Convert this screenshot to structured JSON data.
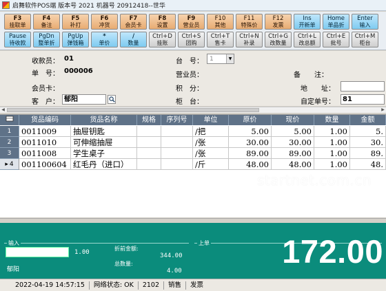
{
  "window": {
    "title": "启舞软件POS端 版本号 2021 机器号 20912418--世华"
  },
  "toolbar": {
    "row1": [
      {
        "key": "F3",
        "label": "挂取单",
        "style": "orange"
      },
      {
        "key": "F4",
        "label": "备注",
        "style": "orange"
      },
      {
        "key": "F5",
        "label": "补打",
        "style": "orange"
      },
      {
        "key": "F6",
        "label": "冲货",
        "style": "orange"
      },
      {
        "key": "F7",
        "label": "会员卡",
        "style": "orange"
      },
      {
        "key": "F8",
        "label": "设置",
        "style": "orange"
      },
      {
        "key": "F9",
        "label": "营业员",
        "style": "orange"
      },
      {
        "key": "F10",
        "label": "其他",
        "style": "orange"
      },
      {
        "key": "F11",
        "label": "特殊价",
        "style": "orange"
      },
      {
        "key": "F12",
        "label": "发票",
        "style": "orange"
      },
      {
        "key": "Ins",
        "label": "开新单",
        "style": "blue"
      },
      {
        "key": "Home",
        "label": "单品折",
        "style": "blue"
      },
      {
        "key": "Enter",
        "label": "输入",
        "style": "blue"
      }
    ],
    "row2": [
      {
        "key": "Pause",
        "label": "待收款",
        "style": "blue"
      },
      {
        "key": "PgDn",
        "label": "整单折",
        "style": "blue"
      },
      {
        "key": "PgUp",
        "label": "弹钱箱",
        "style": "blue"
      },
      {
        "key": "*",
        "label": "单价",
        "style": "blue"
      },
      {
        "key": "/",
        "label": "数量",
        "style": "blue"
      },
      {
        "key": "Ctrl+D",
        "label": "挂账",
        "style": "gray"
      },
      {
        "key": "Ctrl+S",
        "label": "团购",
        "style": "gray"
      },
      {
        "key": "Ctrl+T",
        "label": "售卡",
        "style": "gray"
      },
      {
        "key": "Ctrl+N",
        "label": "补录",
        "style": "gray"
      },
      {
        "key": "Ctrl+G",
        "label": "改数量",
        "style": "gray"
      },
      {
        "key": "Ctrl+L",
        "label": "改总额",
        "style": "gray"
      },
      {
        "key": "Ctrl+E",
        "label": "批号",
        "style": "gray"
      },
      {
        "key": "Ctrl+M",
        "label": "柜台",
        "style": "gray"
      }
    ]
  },
  "form": {
    "cashier_label": "收款员：",
    "cashier_value": "01",
    "order_label": "单　号：",
    "order_value": "000006",
    "member_label": "会员卡：",
    "customer_label": "客　户：",
    "customer_value": "郁阳",
    "platform_label": "台　号：",
    "platform_value": "1",
    "salesperson_label": "营业员：",
    "points_label": "积　分：",
    "counter_label": "柜　台：",
    "remark_label": "备　　注：",
    "address_label": "地　　址：",
    "custom_order_label": "自定单号：",
    "custom_order_value": "81"
  },
  "table": {
    "headers": [
      "货品编码",
      "货品名称",
      "规格",
      "序列号",
      "单位",
      "原价",
      "现价",
      "数量",
      "金额"
    ],
    "rows": [
      {
        "idx": "1",
        "code": "0011009",
        "name": "抽屉钥匙",
        "spec": "",
        "serial": "",
        "unit": "/把",
        "orig": "5.00",
        "price": "5.00",
        "qty": "1.00",
        "amount": "5."
      },
      {
        "idx": "2",
        "code": "0011010",
        "name": "可伸缩抽屉",
        "spec": "",
        "serial": "",
        "unit": "/张",
        "orig": "30.00",
        "price": "30.00",
        "qty": "1.00",
        "amount": "30."
      },
      {
        "idx": "3",
        "code": "0011008",
        "name": "学生桌子",
        "spec": "",
        "serial": "",
        "unit": "/张",
        "orig": "89.00",
        "price": "89.00",
        "qty": "1.00",
        "amount": "89."
      },
      {
        "idx": "4",
        "code": "001100604",
        "name": "红毛丹（进口）",
        "spec": "",
        "serial": "",
        "unit": "/斤",
        "orig": "48.00",
        "price": "48.00",
        "qty": "1.00",
        "amount": "48."
      }
    ]
  },
  "watermark": "startnet.com.cn",
  "summary": {
    "input_title": "输入",
    "input_qty": "1.00",
    "pre_discount_label": "折前金额:",
    "pre_discount_value": "344.00",
    "total_qty_label": "总数量:",
    "total_qty_value": "4.00",
    "customer_name": "郁阳",
    "last_title": "上单",
    "total_due": "172.00"
  },
  "status": {
    "datetime": "2022-04-19 14:57:15",
    "network": "网络状态: OK",
    "code": "2102",
    "mode": "销售",
    "invoice": "发票"
  }
}
